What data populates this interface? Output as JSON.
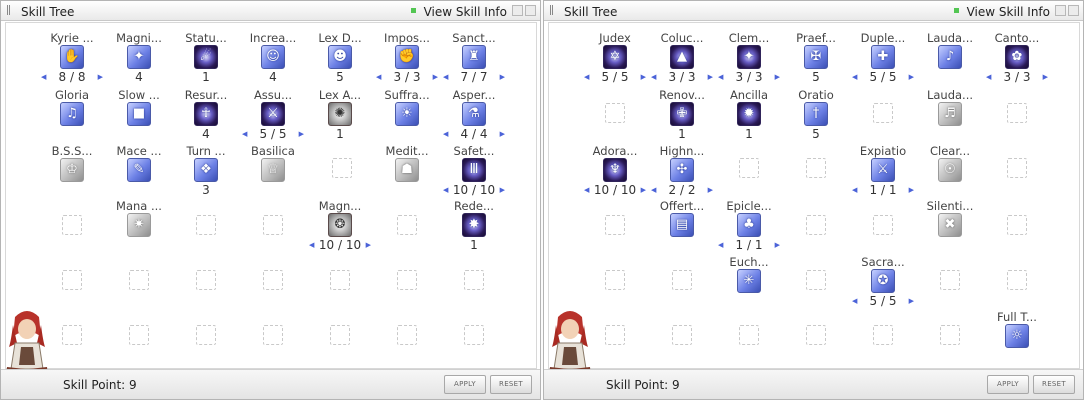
{
  "left": {
    "title": "Skill Tree",
    "info": "View Skill Info",
    "skill_point_label": "Skill Point: 9",
    "apply": "APPLY",
    "reset": "RESET",
    "skills": [
      {
        "name": "Kyrie ...",
        "level": "8 / 8",
        "glyph": "✋"
      },
      {
        "name": "Magni...",
        "level": "4",
        "glyph": "✦"
      },
      {
        "name": "Statu...",
        "level": "1",
        "glyph": "☄"
      },
      {
        "name": "Increa...",
        "level": "4",
        "glyph": "☺"
      },
      {
        "name": "Lex D...",
        "level": "5",
        "glyph": "☻"
      },
      {
        "name": "Impos...",
        "level": "3 / 3",
        "glyph": "✊"
      },
      {
        "name": "Sanct...",
        "level": "7 / 7",
        "glyph": "♜"
      },
      {
        "name": "Gloria",
        "level": "",
        "glyph": "♫"
      },
      {
        "name": "Slow ...",
        "level": "",
        "glyph": "■"
      },
      {
        "name": "Resur...",
        "level": "4",
        "glyph": "☥"
      },
      {
        "name": "Assu...",
        "level": "5 / 5",
        "glyph": "⚔"
      },
      {
        "name": "Lex A...",
        "level": "1",
        "glyph": "✺"
      },
      {
        "name": "Suffra...",
        "level": "",
        "glyph": "☀"
      },
      {
        "name": "Asper...",
        "level": "4 / 4",
        "glyph": "⚗"
      },
      {
        "name": "B.S.S...",
        "level": "",
        "glyph": "♔"
      },
      {
        "name": "Mace ...",
        "level": "",
        "glyph": "✎"
      },
      {
        "name": "Turn ...",
        "level": "3",
        "glyph": "❖"
      },
      {
        "name": "Basilica",
        "level": "",
        "glyph": "♕"
      },
      {
        "name": "Medit...",
        "level": "",
        "glyph": "☗"
      },
      {
        "name": "Safet...",
        "level": "10 / 10",
        "glyph": "Ⅲ"
      },
      {
        "name": "Mana ...",
        "level": "",
        "glyph": "✷"
      },
      {
        "name": "Magn...",
        "level": "10 / 10",
        "glyph": "❂"
      },
      {
        "name": "Rede...",
        "level": "1",
        "glyph": "✸"
      }
    ]
  },
  "right": {
    "title": "Skill Tree",
    "info": "View Skill Info",
    "skill_point_label": "Skill Point: 9",
    "apply": "APPLY",
    "reset": "RESET",
    "skills": [
      {
        "name": "Judex",
        "level": "5 / 5",
        "glyph": "✡"
      },
      {
        "name": "Coluc...",
        "level": "3 / 3",
        "glyph": "▲"
      },
      {
        "name": "Clem...",
        "level": "3 / 3",
        "glyph": "✦"
      },
      {
        "name": "Praef...",
        "level": "5",
        "glyph": "✠"
      },
      {
        "name": "Duple...",
        "level": "5 / 5",
        "glyph": "✚"
      },
      {
        "name": "Lauda...",
        "level": "",
        "glyph": "♪"
      },
      {
        "name": "Canto...",
        "level": "3 / 3",
        "glyph": "✿"
      },
      {
        "name": "Renov...",
        "level": "1",
        "glyph": "✙"
      },
      {
        "name": "Ancilla",
        "level": "1",
        "glyph": "✹"
      },
      {
        "name": "Oratio",
        "level": "5",
        "glyph": "†"
      },
      {
        "name": "Lauda...",
        "level": "",
        "glyph": "♬"
      },
      {
        "name": "Adora...",
        "level": "10 / 10",
        "glyph": "♆"
      },
      {
        "name": "Highn...",
        "level": "2 / 2",
        "glyph": "✣"
      },
      {
        "name": "Expiatio",
        "level": "1 / 1",
        "glyph": "⚔"
      },
      {
        "name": "Clear...",
        "level": "",
        "glyph": "☉"
      },
      {
        "name": "Offert...",
        "level": "",
        "glyph": "▤"
      },
      {
        "name": "Epicle...",
        "level": "1 / 1",
        "glyph": "♣"
      },
      {
        "name": "Silenti...",
        "level": "",
        "glyph": "✖"
      },
      {
        "name": "Euch...",
        "level": "",
        "glyph": "✳"
      },
      {
        "name": "Sacra...",
        "level": "5 / 5",
        "glyph": "✪"
      },
      {
        "name": "Full T...",
        "level": "",
        "glyph": "☼"
      }
    ]
  }
}
